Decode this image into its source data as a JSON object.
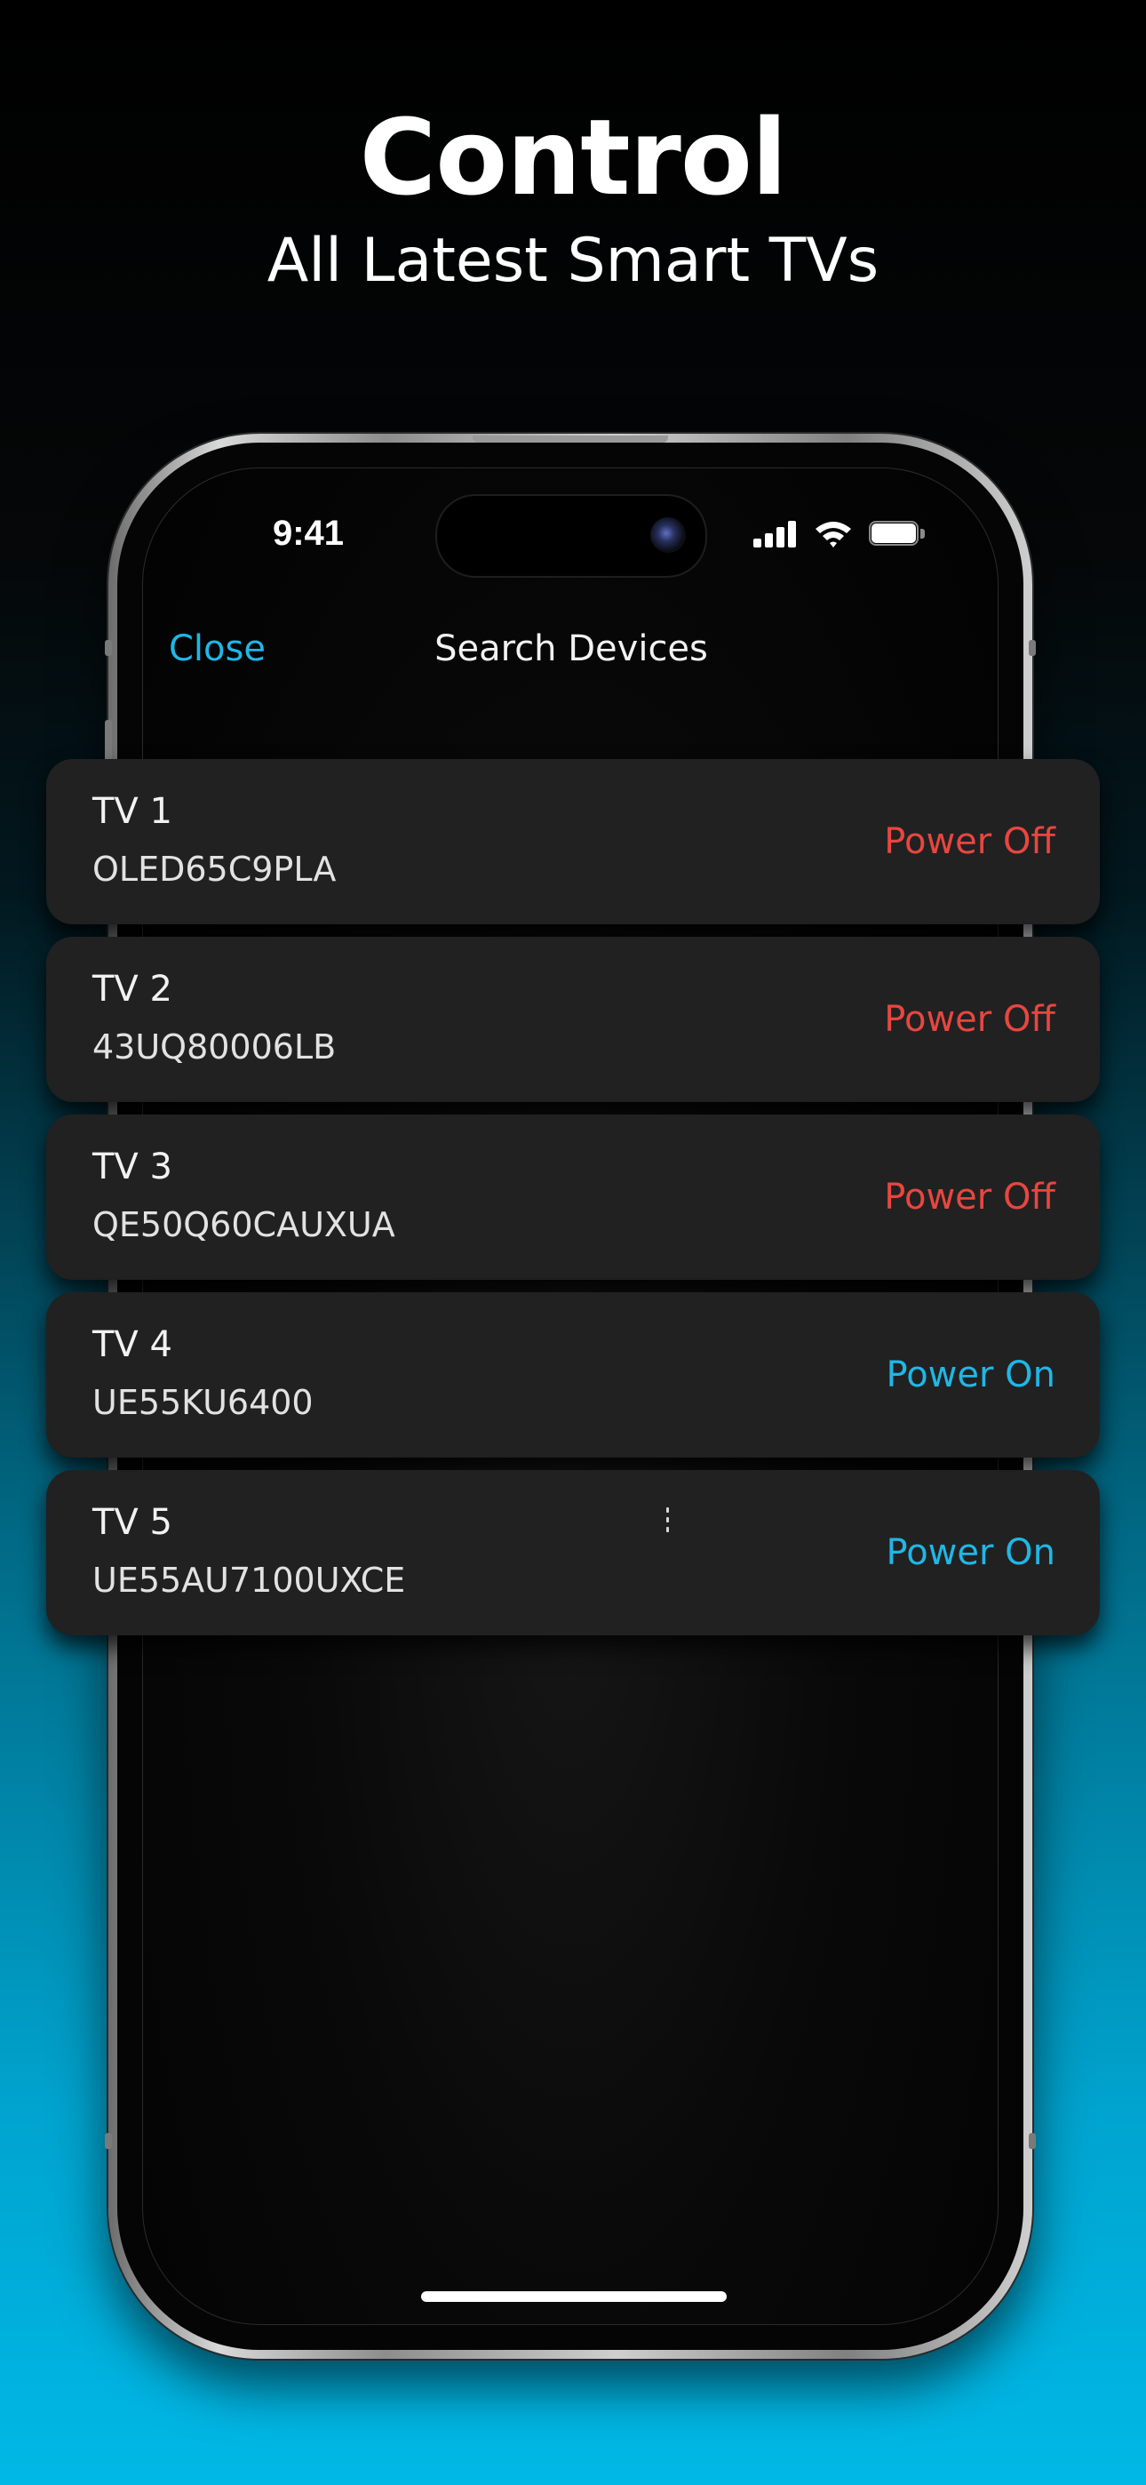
{
  "promo": {
    "headline": "Control",
    "subheadline": "All Latest Smart TVs"
  },
  "status_bar": {
    "time": "9:41",
    "icons": [
      "signal-icon",
      "wifi-icon",
      "battery-icon"
    ]
  },
  "nav": {
    "close_label": "Close",
    "title": "Search Devices"
  },
  "colors": {
    "accent": "#1FB7E6",
    "power_off": "#E8463F",
    "power_on": "#1FB7E6",
    "card_background": "#212122"
  },
  "devices": [
    {
      "name": "TV 1",
      "model": "OLED65C9PLA",
      "status": "Power Off",
      "state": "off"
    },
    {
      "name": "TV 2",
      "model": "43UQ80006LB",
      "status": "Power Off",
      "state": "off"
    },
    {
      "name": "TV 3",
      "model": "QE50Q60CAUXUA",
      "status": "Power Off",
      "state": "off"
    },
    {
      "name": "TV 4",
      "model": "UE55KU6400",
      "status": "Power On",
      "state": "on"
    },
    {
      "name": "TV 5",
      "model": "UE55AU7100UXCE",
      "status": "Power On",
      "state": "on"
    }
  ]
}
